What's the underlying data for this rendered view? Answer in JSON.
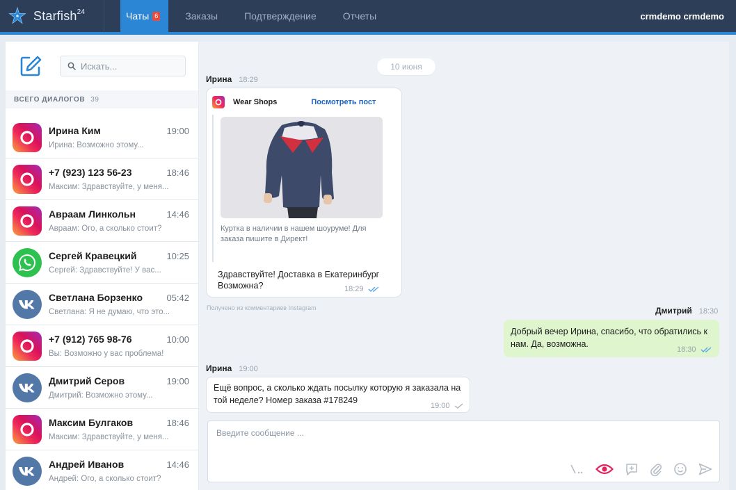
{
  "app": {
    "name": "Starfish",
    "superscript": "24"
  },
  "nav": {
    "tabs": [
      {
        "label": "Чаты",
        "badge": "6",
        "active": true
      },
      {
        "label": "Заказы"
      },
      {
        "label": "Подтверждение"
      },
      {
        "label": "Отчеты"
      }
    ],
    "user": "crmdemo crmdemo"
  },
  "sidebar": {
    "search_placeholder": "Искать...",
    "dialogs_label": "ВСЕГО ДИАЛОГОВ",
    "dialogs_count": "39",
    "items": [
      {
        "name": "Ирина Ким",
        "time": "19:00",
        "preview": "Ирина: Возможно этому...",
        "channel": "instagram"
      },
      {
        "name": "+7 (923) 123 56-23",
        "time": "18:46",
        "preview": "Максим: Здравствуйте, у меня...",
        "channel": "instagram"
      },
      {
        "name": "Авраам Линкольн",
        "time": "14:46",
        "preview": "Авраам: Ого, а сколько стоит?",
        "channel": "instagram"
      },
      {
        "name": "Сергей Кравецкий",
        "time": "10:25",
        "preview": "Сергей: Здравствуйте! У вас...",
        "channel": "whatsapp"
      },
      {
        "name": "Светлана Борзенко",
        "time": "05:42",
        "preview": "Светлана: Я не думаю, что это...",
        "channel": "vk"
      },
      {
        "name": "+7 (912) 765 98-76",
        "time": "10:00",
        "preview": "Вы: Возможно у вас проблема!",
        "channel": "instagram"
      },
      {
        "name": "Дмитрий Серов",
        "time": "19:00",
        "preview": "Дмитрий: Возможно этому...",
        "channel": "vk"
      },
      {
        "name": "Максим Булгаков",
        "time": "18:46",
        "preview": "Максим: Здравствуйте, у меня...",
        "channel": "instagram"
      },
      {
        "name": "Андрей Иванов",
        "time": "14:46",
        "preview": "Андрей: Ого, а сколько стоит?",
        "channel": "vk"
      }
    ]
  },
  "chat": {
    "date": "10 июня",
    "messages": [
      {
        "sender": "Ирина",
        "time": "18:29",
        "post": {
          "shop": "Wear Shops",
          "link": "Посмотреть пост",
          "caption": "Куртка в наличии в нашем шоуруме! Для заказа пишите в Директ!"
        },
        "text": "Здравствуйте! Доставка в Екатеринбург Возможна?",
        "stamp": "18:29",
        "footnote": "Получено из комментариев Instagram"
      },
      {
        "sender": "Дмитрий",
        "time": "18:30",
        "text": "Добрый вечер Ирина, спасибо, что обратились к нам. Да, возможна.",
        "stamp": "18:30"
      },
      {
        "sender": "Ирина",
        "time": "19:00",
        "text": "Ещё вопрос, а сколько ждать посылку которую я заказала на той неделе? Номер заказа #178249",
        "stamp": "19:00"
      }
    ],
    "composer": {
      "placeholder": "Введите сообщение ..."
    }
  },
  "colors": {
    "topbar": "#2c3e58",
    "accent": "#2b86d6",
    "badge": "#e74c3c",
    "outgoing_bubble": "#dff5cd",
    "link": "#1e63c0"
  }
}
